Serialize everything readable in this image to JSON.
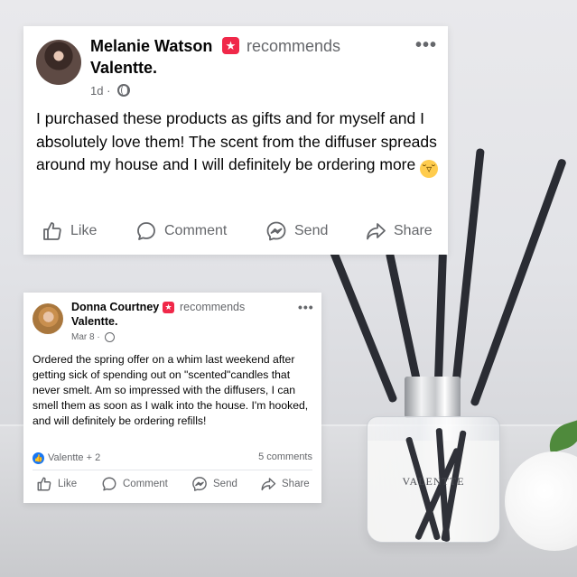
{
  "brand": {
    "product_label": "VALENTTE"
  },
  "posts": [
    {
      "author": "Melanie Watson",
      "recommends_text": "recommends",
      "page": "Valentte",
      "time": "1d",
      "body": "I purchased these products as gifts and for myself and I absolutely love them!  The scent from the diffuser spreads around my house and I will definitely be ordering more",
      "emoji": "😁",
      "actions": {
        "like": "Like",
        "comment": "Comment",
        "send": "Send",
        "share": "Share"
      }
    },
    {
      "author": "Donna Courtney",
      "recommends_text": "recommends",
      "page": "Valentte",
      "time": "Mar 8",
      "body": "Ordered the spring offer on a whim last weekend after getting sick of spending out on \"scented\"candles that never smelt. Am so impressed with the diffusers, I can smell them as soon as I walk into the house. I'm hooked, and will definitely be ordering refills!",
      "reactions": "Valentte + 2",
      "comments": "5 comments",
      "actions": {
        "like": "Like",
        "comment": "Comment",
        "send": "Send",
        "share": "Share"
      }
    }
  ],
  "colors": {
    "recommend_badge": "#f02849",
    "like_blue": "#1877f2",
    "muted_text": "#65676b"
  }
}
